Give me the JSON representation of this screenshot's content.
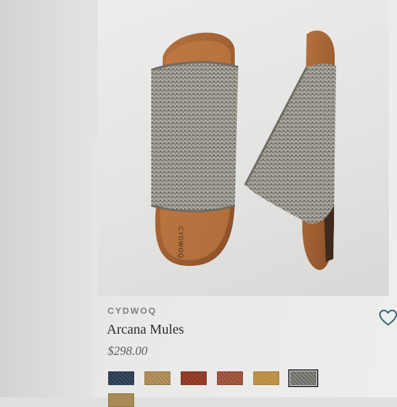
{
  "product": {
    "brand": "CYDWOQ",
    "name": "Arcana Mules",
    "price": "$298.00",
    "image_icon": "product-photo"
  },
  "wishlist": {
    "icon": "heart-outline-icon",
    "color": "#3d6f7d"
  },
  "swatches": [
    {
      "name": "navy",
      "color": "#24384f"
    },
    {
      "name": "tan",
      "color": "#a8854d"
    },
    {
      "name": "red-brown",
      "color": "#8e3520"
    },
    {
      "name": "rust",
      "color": "#9a4b32"
    },
    {
      "name": "honey",
      "color": "#b88a3a"
    },
    {
      "name": "grey-knit",
      "color": "#6b6b66",
      "selected": true
    },
    {
      "name": "camel",
      "color": "#a98a55"
    }
  ],
  "colors": {
    "brand_text": "#7c8285",
    "title_text": "#2b2f31",
    "price_text": "#5b6164"
  }
}
